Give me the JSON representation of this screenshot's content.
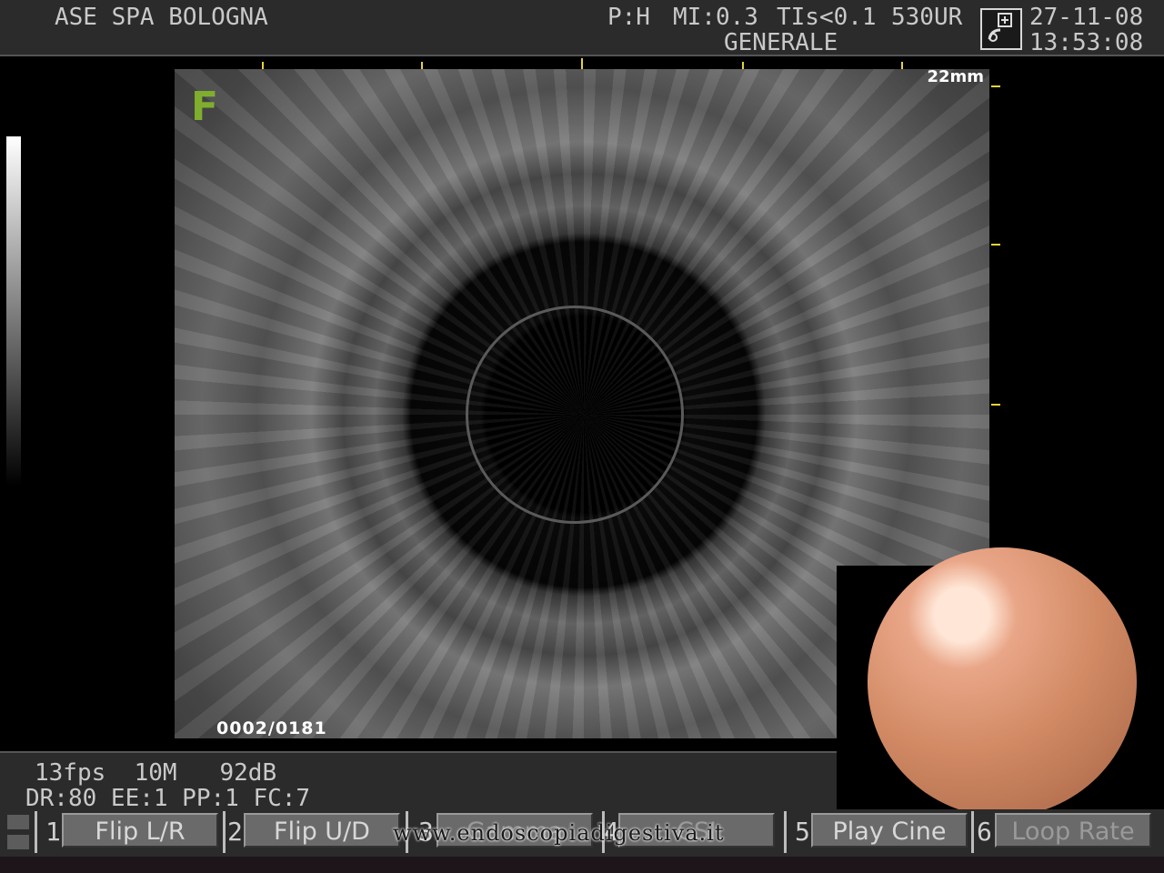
{
  "header": {
    "institution": "ASE SPA BOLOGNA",
    "power": "P:H",
    "mi": "MI:0.3",
    "tis": "TIs<0.1",
    "probe": "530UR",
    "preset": "GENERALE",
    "date": "27-11-08",
    "time": "13:53:08",
    "probe_icon": "probe-icon"
  },
  "image": {
    "frame_marker": "F",
    "depth": "22mm",
    "frame_counter": "0002/0181"
  },
  "status": {
    "line1": "13fps  10M   92dB",
    "line2": "DR:80 EE:1 PP:1 FC:7"
  },
  "softkeys": [
    {
      "num": "1",
      "label": "Flip L/R"
    },
    {
      "num": "2",
      "label": "Flip U/D"
    },
    {
      "num": "3",
      "label": "Gamma"
    },
    {
      "num": "4",
      "label": "CSI"
    },
    {
      "num": "5",
      "label": "Play Cine"
    },
    {
      "num": "6",
      "label": "Loop Rate"
    }
  ],
  "watermark": "www.endoscopiadigestiva.it",
  "colors": {
    "tick": "#e6d23a",
    "frame_marker": "#7fae2f",
    "panel": "#2b2b2b"
  }
}
